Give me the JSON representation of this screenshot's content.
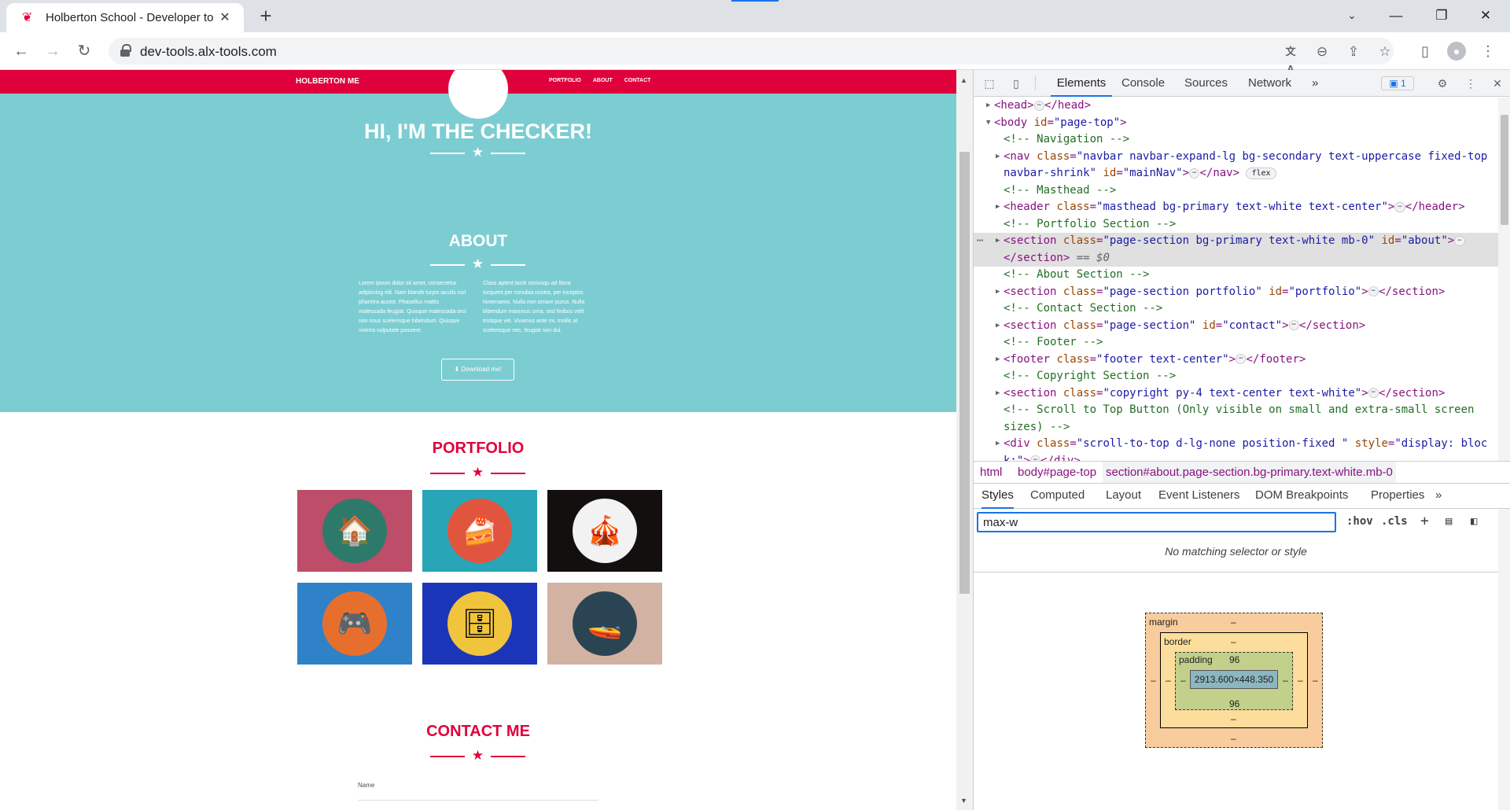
{
  "browser": {
    "tab_title": "Holberton School - Developer to",
    "url": "dev-tools.alx-tools.com"
  },
  "site": {
    "brand": "HOLBERTON ME",
    "nav": [
      "PORTFOLIO",
      "ABOUT",
      "CONTACT"
    ],
    "hero_title": "HI, I'M THE CHECKER!",
    "about_title": "ABOUT",
    "about_left": "Lorem ipsum dolor sit amet, consectetur adipiscing elit. Nam blandit turpis iaculis nisl pharetra auctor. Phasellus mattis malesuada feugiat. Quisque malesuada orci non risus scelerisque bibendum. Quisque viverra vulputate posuere.",
    "about_right": "Class aptent taciti sociosqu ad litora torquent per conubia nostra, per inceptos himenaeos. Nulla non ornare purus. Nulla bibendum maximus urna, sed finibus velit tristique vel. Vivamus ante mi, mollis at scelerisque nec, feugiat non dui.",
    "download_label": "Download me!",
    "portfolio_title": "PORTFOLIO",
    "portfolio_items": [
      {
        "name": "cabin",
        "bg": "#bd4d68",
        "circle": "#2d7a6a",
        "glyph": "🏠"
      },
      {
        "name": "cake",
        "bg": "#28a6b8",
        "circle": "#e1553f",
        "glyph": "🍰"
      },
      {
        "name": "circus",
        "bg": "#130f0e",
        "circle": "#f2f2f2",
        "glyph": "🎪"
      },
      {
        "name": "game",
        "bg": "#2f82c8",
        "circle": "#e76f2e",
        "glyph": "🎮"
      },
      {
        "name": "safe",
        "bg": "#1b35b8",
        "circle": "#f0c43d",
        "glyph": "🗄"
      },
      {
        "name": "submarine",
        "bg": "#d1b2a3",
        "circle": "#2b4454",
        "glyph": "🚤"
      }
    ],
    "contact_title": "CONTACT ME",
    "name_label": "Name"
  },
  "devtools": {
    "tabs": [
      "Elements",
      "Console",
      "Sources",
      "Network",
      "»"
    ],
    "issues_count": "1",
    "breadcrumbs": [
      "html",
      "body#page-top",
      "section#about.page-section.bg-primary.text-white.mb-0"
    ],
    "styles_tabs": [
      "Styles",
      "Computed",
      "Layout",
      "Event Listeners",
      "DOM Breakpoints",
      "Properties",
      "»"
    ],
    "filter_value": "max-w",
    "hov": ":hov",
    "cls": ".cls",
    "no_match": "No matching selector or style",
    "box_model": {
      "margin_label": "margin",
      "border_label": "border",
      "padding_label": "padding",
      "padding_top": "96",
      "padding_bottom": "96",
      "content_size": "2913.600×448.350",
      "dash": "–"
    },
    "dom": {
      "head_tag": "<head>",
      "head_close": "</head>",
      "body_open_tag": "<body ",
      "body_id_attr": "id",
      "body_id_val": "\"page-top\"",
      "c_navigation": "<!-- Navigation -->",
      "nav_open": "<nav ",
      "nav_class_val_1": "\"navbar navbar-expand-lg bg-secondary text-uppercase fixed-top",
      "nav_class_val_2": "navbar-shrink\"",
      "nav_id_val": "\"mainNav\"",
      "nav_close": "</nav>",
      "flex_badge": "flex",
      "c_masthead": "<!-- Masthead -->",
      "header_open": "<header ",
      "header_class_val": "\"masthead bg-primary text-white text-center\"",
      "header_close": "</header>",
      "c_portfolio": "<!-- Portfolio Section -->",
      "section_open": "<section ",
      "about_class_val": "\"page-section bg-primary text-white mb-0\"",
      "about_id_val": "\"about\"",
      "section_close": "</section>",
      "eq_sel": "== $0",
      "c_about": "<!-- About Section -->",
      "portfolio_class_val": "\"page-section portfolio\"",
      "portfolio_id_val": "\"portfolio\"",
      "c_contact": "<!-- Contact Section -->",
      "contact_class_val": "\"page-section\"",
      "contact_id_val": "\"contact\"",
      "c_footer": "<!-- Footer -->",
      "footer_open": "<footer ",
      "footer_class_val": "\"footer text-center\"",
      "footer_close": "</footer>",
      "c_copyright": "<!-- Copyright Section -->",
      "copyright_class_val": "\"copyright py-4 text-center text-white\"",
      "c_scroll_1": "<!-- Scroll to Top Button (Only visible on small and extra-small screen",
      "c_scroll_2": "sizes) -->",
      "div_open": "<div ",
      "div_class_val": "\"scroll-to-top d-lg-none position-fixed \"",
      "div_style_attr": "style",
      "div_style_val_1": "\"display: bloc",
      "div_style_val_2": "k;\"",
      "div_close": "</div>",
      "class_attr": "class",
      "id_attr": "id",
      "gt": ">",
      "eq": "=",
      "dots": "⋯"
    }
  },
  "icons": {
    "tab_favicon": "favicon-icon",
    "close": "close-icon"
  }
}
